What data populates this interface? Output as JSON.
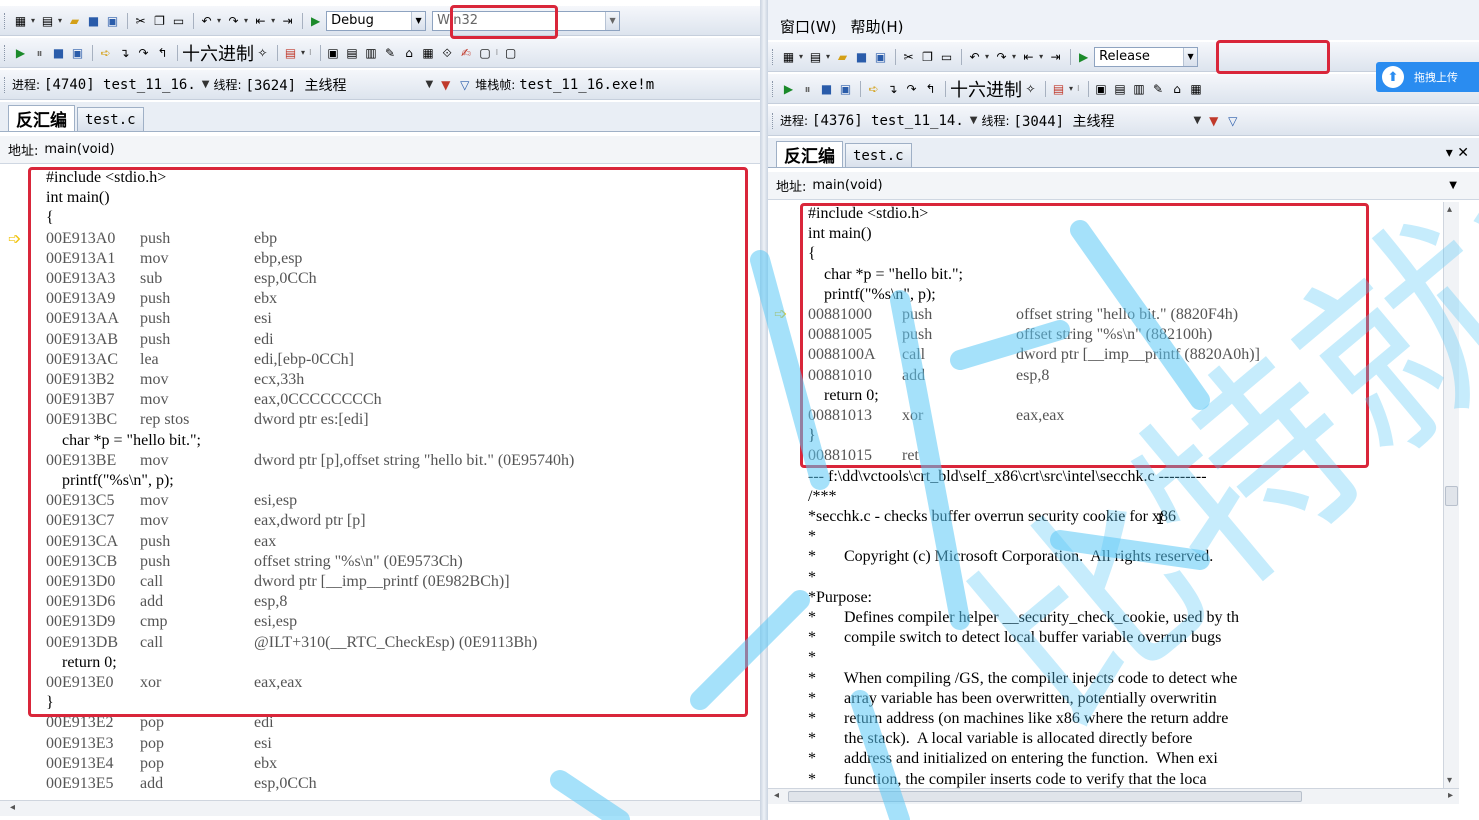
{
  "left": {
    "toolbar1": {
      "config": "Debug",
      "platform": "Win32"
    },
    "toolbar2": {
      "hex_label": "十六进制"
    },
    "toolbar3": {
      "process_label": "进程:",
      "process": "[4740] test_11_16.",
      "thread_label": "线程:",
      "thread": "[3624] 主线程",
      "stack_label": "堆栈帧:",
      "stack": "test_11_16.exe!m"
    },
    "tabs": [
      {
        "label": "反汇编"
      },
      {
        "label": "test.c"
      }
    ],
    "address_label": "地址:",
    "address": "main(void)",
    "lines": [
      {
        "t": "src",
        "s": "#include <stdio.h>"
      },
      {
        "t": "src",
        "s": "int main()"
      },
      {
        "t": "src",
        "s": "{"
      },
      {
        "t": "asm",
        "a": "00E913A0",
        "m": "push",
        "o": "ebp"
      },
      {
        "t": "asm",
        "a": "00E913A1",
        "m": "mov",
        "o": "ebp,esp"
      },
      {
        "t": "asm",
        "a": "00E913A3",
        "m": "sub",
        "o": "esp,0CCh"
      },
      {
        "t": "asm",
        "a": "00E913A9",
        "m": "push",
        "o": "ebx"
      },
      {
        "t": "asm",
        "a": "00E913AA",
        "m": "push",
        "o": "esi"
      },
      {
        "t": "asm",
        "a": "00E913AB",
        "m": "push",
        "o": "edi"
      },
      {
        "t": "asm",
        "a": "00E913AC",
        "m": "lea",
        "o": "edi,[ebp-0CCh]"
      },
      {
        "t": "asm",
        "a": "00E913B2",
        "m": "mov",
        "o": "ecx,33h"
      },
      {
        "t": "asm",
        "a": "00E913B7",
        "m": "mov",
        "o": "eax,0CCCCCCCCh"
      },
      {
        "t": "asm",
        "a": "00E913BC",
        "m": "rep stos",
        "o": "dword ptr es:[edi]"
      },
      {
        "t": "src",
        "s": "    char *p = \"hello bit.\";"
      },
      {
        "t": "asm",
        "a": "00E913BE",
        "m": "mov",
        "o": "dword ptr [p],offset string \"hello bit.\" (0E95740h)"
      },
      {
        "t": "src",
        "s": "    printf(\"%s\\n\", p);"
      },
      {
        "t": "asm",
        "a": "00E913C5",
        "m": "mov",
        "o": "esi,esp"
      },
      {
        "t": "asm",
        "a": "00E913C7",
        "m": "mov",
        "o": "eax,dword ptr [p]"
      },
      {
        "t": "asm",
        "a": "00E913CA",
        "m": "push",
        "o": "eax"
      },
      {
        "t": "asm",
        "a": "00E913CB",
        "m": "push",
        "o": "offset string \"%s\\n\" (0E9573Ch)"
      },
      {
        "t": "asm",
        "a": "00E913D0",
        "m": "call",
        "o": "dword ptr [__imp__printf (0E982BCh)]"
      },
      {
        "t": "asm",
        "a": "00E913D6",
        "m": "add",
        "o": "esp,8"
      },
      {
        "t": "asm",
        "a": "00E913D9",
        "m": "cmp",
        "o": "esi,esp"
      },
      {
        "t": "asm",
        "a": "00E913DB",
        "m": "call",
        "o": "@ILT+310(__RTC_CheckEsp) (0E9113Bh)"
      },
      {
        "t": "src",
        "s": "    return 0;"
      },
      {
        "t": "asm",
        "a": "00E913E0",
        "m": "xor",
        "o": "eax,eax"
      },
      {
        "t": "src",
        "s": "}"
      },
      {
        "t": "asm",
        "a": "00E913E2",
        "m": "pop",
        "o": "edi"
      },
      {
        "t": "asm",
        "a": "00E913E3",
        "m": "pop",
        "o": "esi"
      },
      {
        "t": "asm",
        "a": "00E913E4",
        "m": "pop",
        "o": "ebx"
      },
      {
        "t": "asm",
        "a": "00E913E5",
        "m": "add",
        "o": "esp,0CCh"
      }
    ]
  },
  "right": {
    "menu": [
      {
        "label": "窗口(W)"
      },
      {
        "label": "帮助(H)"
      }
    ],
    "toolbar1": {
      "config": "Release"
    },
    "toolbar2": {
      "hex_label": "十六进制"
    },
    "toolbar3": {
      "process_label": "进程:",
      "process": "[4376] test_11_14.",
      "thread_label": "线程:",
      "thread": "[3044] 主线程"
    },
    "tabs": [
      {
        "label": "反汇编"
      },
      {
        "label": "test.c"
      }
    ],
    "tab_controls": "▾ ✕",
    "address_label": "地址:",
    "address": "main(void)",
    "lines": [
      {
        "t": "src",
        "s": "#include <stdio.h>"
      },
      {
        "t": "src",
        "s": "int main()"
      },
      {
        "t": "src",
        "s": "{"
      },
      {
        "t": "src",
        "s": "    char *p = \"hello bit.\";"
      },
      {
        "t": "src",
        "s": "    printf(\"%s\\n\", p);"
      },
      {
        "t": "asm",
        "a": "00881000",
        "m": "push",
        "o": "offset string \"hello bit.\" (8820F4h)"
      },
      {
        "t": "asm",
        "a": "00881005",
        "m": "push",
        "o": "offset string \"%s\\n\" (882100h)"
      },
      {
        "t": "asm",
        "a": "0088100A",
        "m": "call",
        "o": "dword ptr [__imp__printf (8820A0h)]"
      },
      {
        "t": "asm",
        "a": "00881010",
        "m": "add",
        "o": "esp,8"
      },
      {
        "t": "src",
        "s": "    return 0;"
      },
      {
        "t": "asm",
        "a": "00881013",
        "m": "xor",
        "o": "eax,eax"
      },
      {
        "t": "src",
        "s": "}"
      },
      {
        "t": "asm",
        "a": "00881015",
        "m": "ret",
        "o": ""
      },
      {
        "t": "src",
        "s": "--- f:\\dd\\vctools\\crt_bld\\self_x86\\crt\\src\\intel\\secchk.c ---------"
      },
      {
        "t": "src",
        "s": "/***"
      },
      {
        "t": "src",
        "s": "*secchk.c - checks buffer overrun security cookie for x86"
      },
      {
        "t": "src",
        "s": "*"
      },
      {
        "t": "src",
        "s": "*       Copyright (c) Microsoft Corporation.  All rights reserved."
      },
      {
        "t": "src",
        "s": "*"
      },
      {
        "t": "src",
        "s": "*Purpose:"
      },
      {
        "t": "src",
        "s": "*       Defines compiler helper __security_check_cookie, used by th"
      },
      {
        "t": "src",
        "s": "*       compile switch to detect local buffer variable overrun bugs"
      },
      {
        "t": "src",
        "s": "*"
      },
      {
        "t": "src",
        "s": "*       When compiling /GS, the compiler injects code to detect whe"
      },
      {
        "t": "src",
        "s": "*       array variable has been overwritten, potentially overwritin"
      },
      {
        "t": "src",
        "s": "*       return address (on machines like x86 where the return addre"
      },
      {
        "t": "src",
        "s": "*       the stack).  A local variable is allocated directly before"
      },
      {
        "t": "src",
        "s": "*       address and initialized on entering the function.  When exi"
      },
      {
        "t": "src",
        "s": "*       function, the compiler inserts code to verify that the loca"
      }
    ],
    "upload_label": "拖拽上传"
  },
  "watermark_text": "比特就业课",
  "colors": {
    "highlight": "#d9263a",
    "arrow": "#f1c40f",
    "watermark": "#5bc8f5"
  }
}
